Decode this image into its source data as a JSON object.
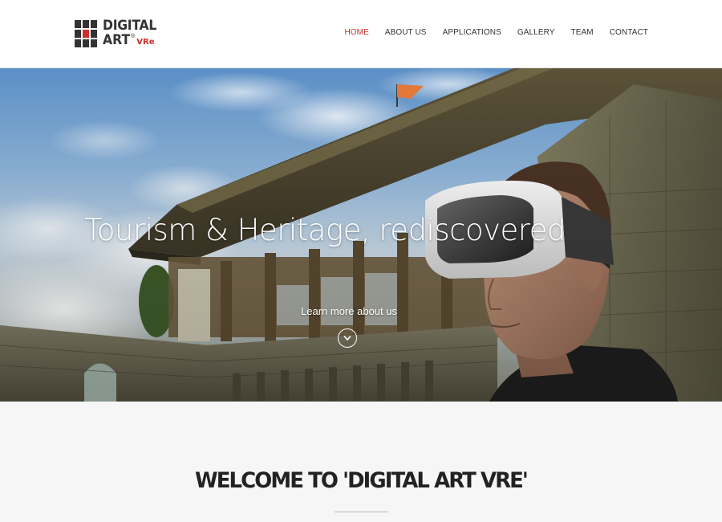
{
  "brand": {
    "line1": "DIGITAL",
    "line2": "ART",
    "registered": "®",
    "suffix": "VRe"
  },
  "nav": {
    "items": [
      {
        "label": "HOME",
        "active": true
      },
      {
        "label": "ABOUT US",
        "active": false
      },
      {
        "label": "APPLICATIONS",
        "active": false
      },
      {
        "label": "GALLERY",
        "active": false
      },
      {
        "label": "TEAM",
        "active": false
      },
      {
        "label": "CONTACT",
        "active": false
      }
    ]
  },
  "hero": {
    "title": "Tourism & Heritage, rediscovered",
    "link": "Learn more about us",
    "scroll_icon": "chevron-down-icon"
  },
  "welcome": {
    "title": "WELCOME TO 'DIGITAL ART VRE'"
  },
  "colors": {
    "accent": "#c9302c",
    "text": "#333333",
    "section_bg": "#f6f6f6"
  }
}
